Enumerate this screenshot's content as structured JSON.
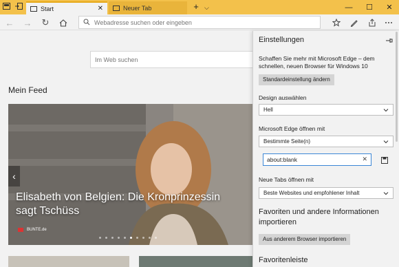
{
  "tabs": [
    {
      "label": "Start",
      "active": true
    },
    {
      "label": "Neuer Tab",
      "active": false
    }
  ],
  "tab_close_glyph": "✕",
  "new_tab_glyph": "+",
  "tab_menu_glyph": "⌵",
  "window_controls": {
    "minimize": "—",
    "maximize": "☐",
    "close": "✕"
  },
  "address_bar": {
    "placeholder": "Webadresse suchen oder eingeben"
  },
  "nav": {
    "back": "←",
    "forward": "→",
    "refresh": "↻"
  },
  "content": {
    "web_search_placeholder": "Im Web suchen",
    "feed_title": "Mein Feed",
    "hero": {
      "title": "Elisabeth von Belgien: Die Kronprinzessin sagt Tschüss",
      "source": "BUNTE.de",
      "prev_glyph": "‹",
      "slide_count": 10,
      "active_slide": 5
    }
  },
  "settings": {
    "title": "Einstellungen",
    "promo_text": "Schaffen Sie mehr mit Microsoft Edge – dem schnellen, neuen Browser für Windows 10",
    "default_button": "Standardeinstellung ändern",
    "design_label": "Design auswählen",
    "design_value": "Hell",
    "open_with_label": "Microsoft Edge öffnen mit",
    "open_with_value": "Bestimmte Seite(n)",
    "page_url": "about:blank",
    "clear_glyph": "✕",
    "new_tabs_label": "Neue Tabs öffnen mit",
    "new_tabs_value": "Beste Websites und empfohlener Inhalt",
    "import_heading": "Favoriten und andere Informationen importieren",
    "import_button": "Aus anderem Browser importieren",
    "favorites_bar_heading": "Favoritenleiste"
  },
  "colors": {
    "titlebar": "#f3c14b",
    "accent": "#3a86d6"
  }
}
